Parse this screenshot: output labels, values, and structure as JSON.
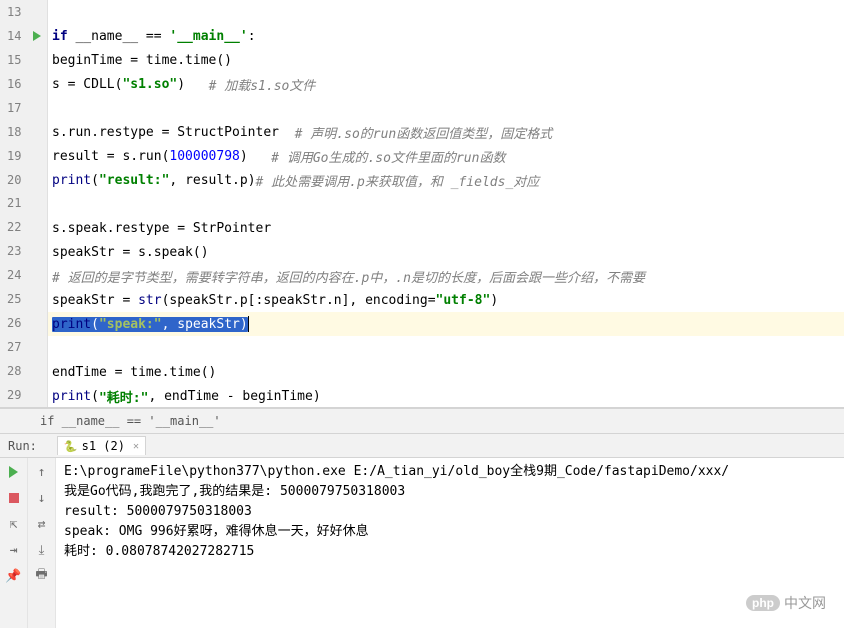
{
  "editor": {
    "lines": [
      {
        "num": 13,
        "tokens": []
      },
      {
        "num": 14,
        "run_gutter": true,
        "tokens": [
          {
            "t": "kw",
            "v": "if "
          },
          {
            "t": "plain",
            "v": "__name__ == "
          },
          {
            "t": "str",
            "v": "'__main__'"
          },
          {
            "t": "plain",
            "v": ":"
          }
        ]
      },
      {
        "num": 15,
        "indent": "    ",
        "tokens": [
          {
            "t": "plain",
            "v": "beginTime = time.time()"
          }
        ]
      },
      {
        "num": 16,
        "indent": "    ",
        "tokens": [
          {
            "t": "plain",
            "v": "s = CDLL("
          },
          {
            "t": "str",
            "v": "\"s1.so\""
          },
          {
            "t": "plain",
            "v": ")   "
          },
          {
            "t": "com",
            "v": "# 加载s1.so文件"
          }
        ]
      },
      {
        "num": 17,
        "tokens": []
      },
      {
        "num": 18,
        "indent": "    ",
        "tokens": [
          {
            "t": "plain",
            "v": "s.run.restype = StructPointer  "
          },
          {
            "t": "com",
            "v": "# 声明.so的run函数返回值类型，固定格式"
          }
        ]
      },
      {
        "num": 19,
        "indent": "    ",
        "tokens": [
          {
            "t": "plain",
            "v": "result = s.run("
          },
          {
            "t": "num",
            "v": "100000798"
          },
          {
            "t": "plain",
            "v": ")   "
          },
          {
            "t": "com",
            "v": "# 调用Go生成的.so文件里面的run函数"
          }
        ]
      },
      {
        "num": 20,
        "indent": "    ",
        "tokens": [
          {
            "t": "builtin",
            "v": "print"
          },
          {
            "t": "plain",
            "v": "("
          },
          {
            "t": "str",
            "v": "\"result:\""
          },
          {
            "t": "plain",
            "v": ", result.p)"
          },
          {
            "t": "com",
            "v": "# 此处需要调用.p来获取值，和 _fields_对应"
          }
        ]
      },
      {
        "num": 21,
        "tokens": []
      },
      {
        "num": 22,
        "indent": "    ",
        "tokens": [
          {
            "t": "plain",
            "v": "s.speak.restype = StrPointer"
          }
        ]
      },
      {
        "num": 23,
        "indent": "    ",
        "tokens": [
          {
            "t": "plain",
            "v": "speakStr = s.speak()"
          }
        ]
      },
      {
        "num": 24,
        "indent": "    ",
        "tokens": [
          {
            "t": "com",
            "v": "# 返回的是字节类型，需要转字符串，返回的内容在.p中，.n是切的长度，后面会跟一些介绍，不需要"
          }
        ]
      },
      {
        "num": 25,
        "indent": "    ",
        "tokens": [
          {
            "t": "plain",
            "v": "speakStr = "
          },
          {
            "t": "builtin",
            "v": "str"
          },
          {
            "t": "plain",
            "v": "(speakStr.p[:speakStr.n], "
          },
          {
            "t": "plain",
            "v": "encoding="
          },
          {
            "t": "str",
            "v": "\"utf-8\""
          },
          {
            "t": "plain",
            "v": ")"
          }
        ]
      },
      {
        "num": 26,
        "highlight": true,
        "indent": "    ",
        "selected": true,
        "sel_tokens": [
          {
            "t": "builtin",
            "v": "print"
          },
          {
            "t": "plain",
            "v": "("
          },
          {
            "t": "str",
            "v": "\"speak:\""
          },
          {
            "t": "plain",
            "v": ", speakStr)"
          }
        ]
      },
      {
        "num": 27,
        "tokens": []
      },
      {
        "num": 28,
        "indent": "    ",
        "tokens": [
          {
            "t": "plain",
            "v": "endTime = time.time()"
          }
        ]
      },
      {
        "num": 29,
        "indent": "    ",
        "tokens": [
          {
            "t": "builtin",
            "v": "print"
          },
          {
            "t": "plain",
            "v": "("
          },
          {
            "t": "str",
            "v": "\"耗时:\""
          },
          {
            "t": "plain",
            "v": ", endTime - beginTime)"
          }
        ]
      }
    ]
  },
  "breadcrumb": "if __name__ == '__main__'",
  "run": {
    "label": "Run:",
    "tab": "s1 (2)",
    "output": [
      "E:\\programeFile\\python377\\python.exe E:/A_tian_yi/old_boy全栈9期_Code/fastapiDemo/xxx/",
      "我是Go代码,我跑完了,我的结果是: 5000079750318003",
      "result: 5000079750318003",
      "speak: OMG 996好累呀，难得休息一天，好好休息",
      "耗时: 0.08078742027282715"
    ]
  },
  "watermark": {
    "badge": "php",
    "text": "中文网"
  }
}
